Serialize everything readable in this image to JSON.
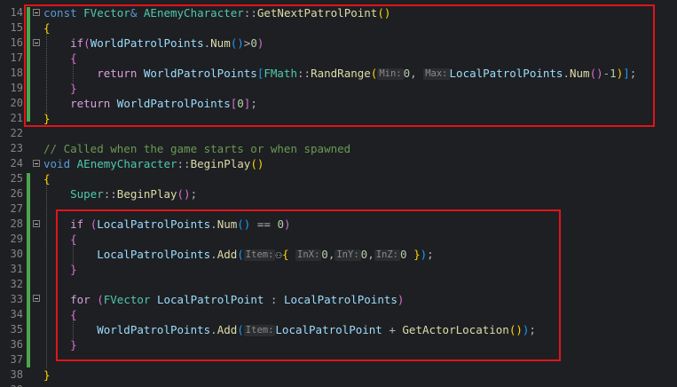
{
  "editor": {
    "lines": [
      {
        "n": "14",
        "tokens": [
          {
            "t": "const ",
            "c": "kw"
          },
          {
            "t": "FVector",
            "c": "typ"
          },
          {
            "t": "& ",
            "c": "kw"
          },
          {
            "t": "AEnemyCharacter",
            "c": "typ"
          },
          {
            "t": "::",
            "c": "op"
          },
          {
            "t": "GetNextPatrolPoint",
            "c": "fn"
          },
          {
            "t": "()",
            "c": "br1"
          }
        ]
      },
      {
        "n": "15",
        "tokens": [
          {
            "t": "{",
            "c": "br1"
          }
        ]
      },
      {
        "n": "16",
        "tokens": [
          {
            "t": "    if",
            "c": "ctl"
          },
          {
            "t": "(",
            "c": "br2"
          },
          {
            "t": "WorldPatrolPoints",
            "c": "var"
          },
          {
            "t": ".",
            "c": "op"
          },
          {
            "t": "Num",
            "c": "fn"
          },
          {
            "t": "()",
            "c": "br3"
          },
          {
            "t": ">",
            "c": "op"
          },
          {
            "t": "0",
            "c": "num"
          },
          {
            "t": ")",
            "c": "br2"
          }
        ]
      },
      {
        "n": "17",
        "tokens": [
          {
            "t": "    {",
            "c": "br2"
          }
        ]
      },
      {
        "n": "18",
        "tokens": [
          {
            "t": "        return ",
            "c": "ctl"
          },
          {
            "t": "WorldPatrolPoints",
            "c": "var"
          },
          {
            "t": "[",
            "c": "br3"
          },
          {
            "t": "FMath",
            "c": "typ"
          },
          {
            "t": "::",
            "c": "op"
          },
          {
            "t": "RandRange",
            "c": "fn"
          },
          {
            "t": "(",
            "c": "br1"
          },
          {
            "t": "Min:",
            "c": "hint"
          },
          {
            "t": "0",
            "c": "num"
          },
          {
            "t": ", ",
            "c": "op"
          },
          {
            "t": "Max:",
            "c": "hint"
          },
          {
            "t": "LocalPatrolPoints",
            "c": "var"
          },
          {
            "t": ".",
            "c": "op"
          },
          {
            "t": "Num",
            "c": "fn"
          },
          {
            "t": "()",
            "c": "br2"
          },
          {
            "t": "-",
            "c": "op"
          },
          {
            "t": "1",
            "c": "num"
          },
          {
            "t": ")",
            "c": "br1"
          },
          {
            "t": "]",
            "c": "br3"
          },
          {
            "t": ";",
            "c": "op"
          }
        ]
      },
      {
        "n": "19",
        "tokens": [
          {
            "t": "    }",
            "c": "br2"
          }
        ]
      },
      {
        "n": "20",
        "tokens": [
          {
            "t": "    return ",
            "c": "ctl"
          },
          {
            "t": "WorldPatrolPoints",
            "c": "var"
          },
          {
            "t": "[",
            "c": "br2"
          },
          {
            "t": "0",
            "c": "num"
          },
          {
            "t": "]",
            "c": "br2"
          },
          {
            "t": ";",
            "c": "op"
          }
        ]
      },
      {
        "n": "21",
        "tokens": [
          {
            "t": "}",
            "c": "br1"
          }
        ]
      },
      {
        "n": "22",
        "tokens": []
      },
      {
        "n": "23",
        "tokens": [
          {
            "t": "// Called when the game starts or when spawned",
            "c": "cm"
          }
        ]
      },
      {
        "n": "24",
        "tokens": [
          {
            "t": "void ",
            "c": "kw"
          },
          {
            "t": "AEnemyCharacter",
            "c": "typ"
          },
          {
            "t": "::",
            "c": "op"
          },
          {
            "t": "BeginPlay",
            "c": "fn"
          },
          {
            "t": "()",
            "c": "br1"
          }
        ]
      },
      {
        "n": "25",
        "tokens": [
          {
            "t": "{",
            "c": "br1"
          }
        ]
      },
      {
        "n": "26",
        "tokens": [
          {
            "t": "    Super",
            "c": "typ"
          },
          {
            "t": "::",
            "c": "op"
          },
          {
            "t": "BeginPlay",
            "c": "fn"
          },
          {
            "t": "()",
            "c": "br2"
          },
          {
            "t": ";",
            "c": "op"
          }
        ]
      },
      {
        "n": "27",
        "tokens": []
      },
      {
        "n": "28",
        "tokens": [
          {
            "t": "    if ",
            "c": "ctl"
          },
          {
            "t": "(",
            "c": "br2"
          },
          {
            "t": "LocalPatrolPoints",
            "c": "var"
          },
          {
            "t": ".",
            "c": "op"
          },
          {
            "t": "Num",
            "c": "fn"
          },
          {
            "t": "()",
            "c": "br3"
          },
          {
            "t": " == ",
            "c": "op"
          },
          {
            "t": "0",
            "c": "num"
          },
          {
            "t": ")",
            "c": "br2"
          }
        ]
      },
      {
        "n": "29",
        "tokens": [
          {
            "t": "    {",
            "c": "br2"
          }
        ]
      },
      {
        "n": "30",
        "tokens": [
          {
            "t": "        LocalPatrolPoints",
            "c": "var"
          },
          {
            "t": ".",
            "c": "op"
          },
          {
            "t": "Add",
            "c": "fn"
          },
          {
            "t": "(",
            "c": "br3"
          },
          {
            "t": "Item:",
            "c": "hint"
          },
          {
            "t": "⚇",
            "c": "op"
          },
          {
            "t": "{ ",
            "c": "br1"
          },
          {
            "t": "InX:",
            "c": "hint"
          },
          {
            "t": "0",
            "c": "num"
          },
          {
            "t": ",",
            "c": "op"
          },
          {
            "t": "InY:",
            "c": "hint"
          },
          {
            "t": "0",
            "c": "num"
          },
          {
            "t": ",",
            "c": "op"
          },
          {
            "t": "InZ:",
            "c": "hint"
          },
          {
            "t": "0 ",
            "c": "num"
          },
          {
            "t": "}",
            "c": "br1"
          },
          {
            "t": ")",
            "c": "br3"
          },
          {
            "t": ";",
            "c": "op"
          }
        ]
      },
      {
        "n": "31",
        "tokens": [
          {
            "t": "    }",
            "c": "br2"
          }
        ]
      },
      {
        "n": "32",
        "tokens": []
      },
      {
        "n": "33",
        "tokens": [
          {
            "t": "    for ",
            "c": "ctl"
          },
          {
            "t": "(",
            "c": "br2"
          },
          {
            "t": "FVector ",
            "c": "typ"
          },
          {
            "t": "LocalPatrolPoint",
            "c": "var"
          },
          {
            "t": " : ",
            "c": "op"
          },
          {
            "t": "LocalPatrolPoints",
            "c": "var"
          },
          {
            "t": ")",
            "c": "br2"
          }
        ]
      },
      {
        "n": "34",
        "tokens": [
          {
            "t": "    {",
            "c": "br2"
          }
        ]
      },
      {
        "n": "35",
        "tokens": [
          {
            "t": "        WorldPatrolPoints",
            "c": "var"
          },
          {
            "t": ".",
            "c": "op"
          },
          {
            "t": "Add",
            "c": "fn"
          },
          {
            "t": "(",
            "c": "br3"
          },
          {
            "t": "Item:",
            "c": "hint"
          },
          {
            "t": "LocalPatrolPoint",
            "c": "var"
          },
          {
            "t": " + ",
            "c": "op"
          },
          {
            "t": "GetActorLocation",
            "c": "fn"
          },
          {
            "t": "()",
            "c": "br1"
          },
          {
            "t": ")",
            "c": "br3"
          },
          {
            "t": ";",
            "c": "op"
          }
        ]
      },
      {
        "n": "36",
        "tokens": [
          {
            "t": "    }",
            "c": "br2"
          }
        ]
      },
      {
        "n": "37",
        "tokens": []
      },
      {
        "n": "38",
        "tokens": [
          {
            "t": "}",
            "c": "br1"
          }
        ]
      },
      {
        "n": "39",
        "tokens": []
      }
    ]
  },
  "colors": {
    "background": "#1e1f22",
    "highlight_box": "#e0141b",
    "change_bar": "#4ca64c"
  }
}
